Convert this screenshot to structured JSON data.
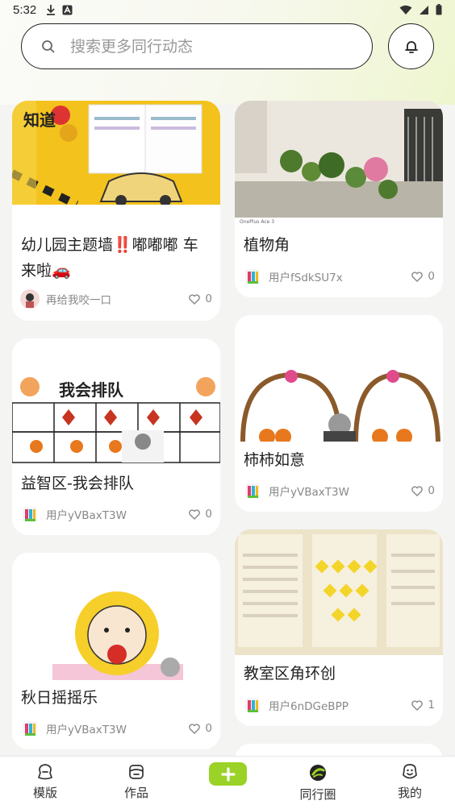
{
  "status_bar": {
    "time": "5:32"
  },
  "search": {
    "placeholder": "搜索更多同行动态"
  },
  "feed": {
    "left": [
      {
        "title": "幼儿园主题墙‼️嘟嘟嘟 车来啦🚗",
        "user": "再给我咬一口",
        "likes": "0",
        "image_label": "知道"
      },
      {
        "title": "益智区-我会排队",
        "user": "用户yVBaxT3W",
        "likes": "0",
        "image_label": "我会排队"
      },
      {
        "title": "秋日摇摇乐",
        "user": "用户yVBaxT3W",
        "likes": "0",
        "image_label": ""
      }
    ],
    "right": [
      {
        "title": "植物角",
        "user": "用户fSdkSU7x",
        "likes": "0",
        "image_label": "OnePlus Ace 3"
      },
      {
        "title": "柿柿如意",
        "user": "用户yVBaxT3W",
        "likes": "0",
        "image_label": ""
      },
      {
        "title": "教室区角环创",
        "user": "用户6nDGeBPP",
        "likes": "1",
        "image_label": ""
      }
    ]
  },
  "bottom_nav": {
    "items": [
      "模版",
      "作品",
      "同行圈",
      "我的"
    ],
    "active": "同行圈"
  },
  "colors": {
    "accent": "#9bd227",
    "text": "#222222",
    "muted": "#888888"
  }
}
